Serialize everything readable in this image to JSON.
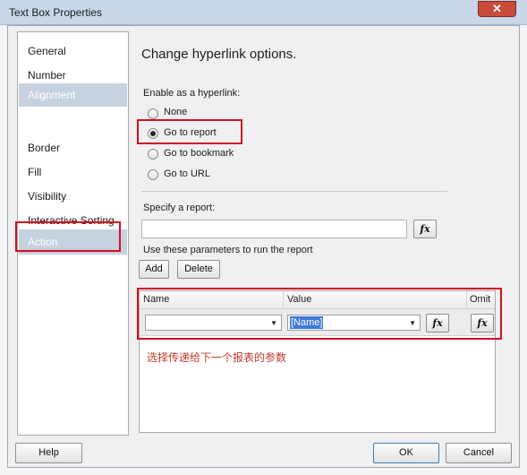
{
  "window": {
    "title": "Text Box Properties",
    "close_glyph": "✕"
  },
  "sidebar": {
    "items": [
      {
        "label": "General"
      },
      {
        "label": "Number"
      },
      {
        "label": "Alignment"
      },
      {
        "label": "Border"
      },
      {
        "label": "Fill"
      },
      {
        "label": "Visibility"
      },
      {
        "label": "Interactive Sorting"
      },
      {
        "label": "Action"
      }
    ]
  },
  "main": {
    "heading": "Change hyperlink options.",
    "enable_label": "Enable as a hyperlink:",
    "options": [
      {
        "label": "None",
        "checked": false
      },
      {
        "label": "Go to report",
        "checked": true
      },
      {
        "label": "Go to bookmark",
        "checked": false
      },
      {
        "label": "Go to URL",
        "checked": false
      }
    ],
    "specify_label": "Specify a report:",
    "report_value": "",
    "fx_label": "fx",
    "params_label": "Use these parameters to run the report",
    "add_label": "Add",
    "delete_label": "Delete",
    "grid": {
      "headers": [
        "Name",
        "Value",
        "Omit"
      ],
      "row": {
        "name": "",
        "value": "[Name]"
      }
    },
    "note": "选择传递给下一个报表的参数"
  },
  "footer": {
    "help": "Help",
    "ok": "OK",
    "cancel": "Cancel"
  },
  "colors": {
    "highlight_border": "#d01020",
    "note_text": "#c0392b",
    "selection": "#c7d2e0"
  }
}
